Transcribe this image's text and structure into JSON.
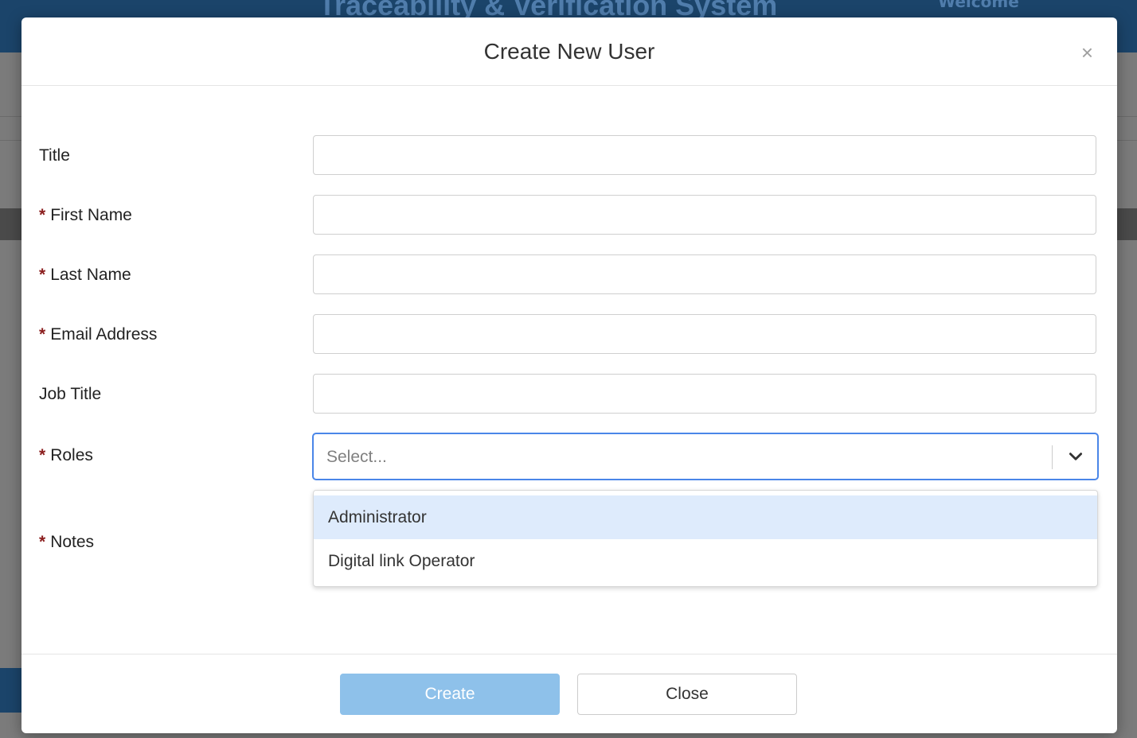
{
  "background": {
    "app_title": "Traceability & Verification System",
    "welcome_text": "Welcome"
  },
  "modal": {
    "title": "Create New User",
    "close_icon": "close-icon",
    "fields": {
      "title": {
        "label": "Title",
        "required": false,
        "value": ""
      },
      "first_name": {
        "label": "First Name",
        "required": true,
        "value": ""
      },
      "last_name": {
        "label": "Last Name",
        "required": true,
        "value": ""
      },
      "email": {
        "label": "Email Address",
        "required": true,
        "value": ""
      },
      "job_title": {
        "label": "Job Title",
        "required": false,
        "value": ""
      },
      "roles": {
        "label": "Roles",
        "required": true,
        "placeholder": "Select...",
        "options": [
          "Administrator",
          "Digital link Operator"
        ],
        "highlighted_option": "Administrator"
      },
      "notes": {
        "label": "Notes",
        "required": true,
        "value": ""
      }
    },
    "required_marker": "*",
    "buttons": {
      "create": "Create",
      "close": "Close"
    }
  },
  "colors": {
    "accent_focus": "#4a86e8",
    "primary_disabled": "#8ec1ea",
    "required_marker": "#8b1e1e",
    "option_highlight": "#deebfc"
  }
}
